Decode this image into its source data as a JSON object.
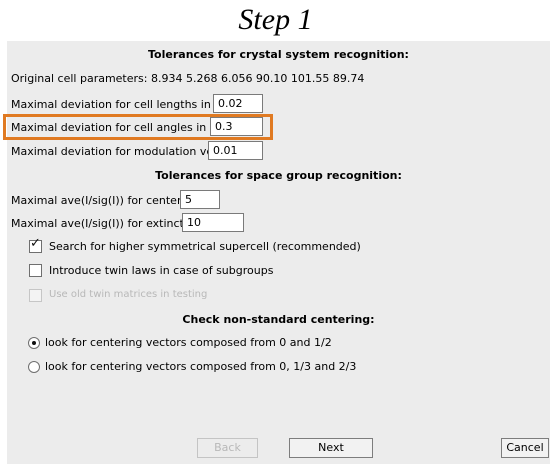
{
  "step_title": "Step 1",
  "sections": {
    "crystal_system": "Tolerances for crystal system recognition:",
    "space_group": "Tolerances for space group recognition:",
    "centering": "Check non-standard centering:"
  },
  "original_cell": "Original cell parameters: 8.934 5.268 6.056 90.10 101.55 89.74",
  "fields": {
    "cell_lengths": {
      "label": "Maximal deviation for cell lengths in [A]",
      "value": "0.02"
    },
    "cell_angles": {
      "label": "Maximal deviation for cell angles in deg",
      "value": "0.3"
    },
    "modulation": {
      "label": "Maximal deviation for modulation vector",
      "value": "0.01"
    },
    "centering_ave": {
      "label": "Maximal ave(I/sig(I)) for centering",
      "value": "5"
    },
    "extinctions_ave": {
      "label": "Maximal ave(I/sig(I)) for extinctions",
      "value": "10"
    }
  },
  "checkboxes": {
    "supercell": {
      "label": "Search for higher symmetrical supercell (recommended)",
      "checked": true
    },
    "twin_laws": {
      "label": "Introduce twin laws in case of subgroups",
      "checked": false
    },
    "old_twin": {
      "label": "Use old twin matrices in testing",
      "checked": false
    }
  },
  "radios": {
    "half": {
      "label": "look for centering vectors composed from 0 and 1/2",
      "selected": true
    },
    "thirds": {
      "label": "look for centering vectors composed from 0, 1/3 and 2/3",
      "selected": false
    }
  },
  "buttons": {
    "back": "Back",
    "next": "Next",
    "cancel": "Cancel"
  },
  "colors": {
    "highlight": "#e07a22",
    "dialog_bg": "#ececec"
  }
}
